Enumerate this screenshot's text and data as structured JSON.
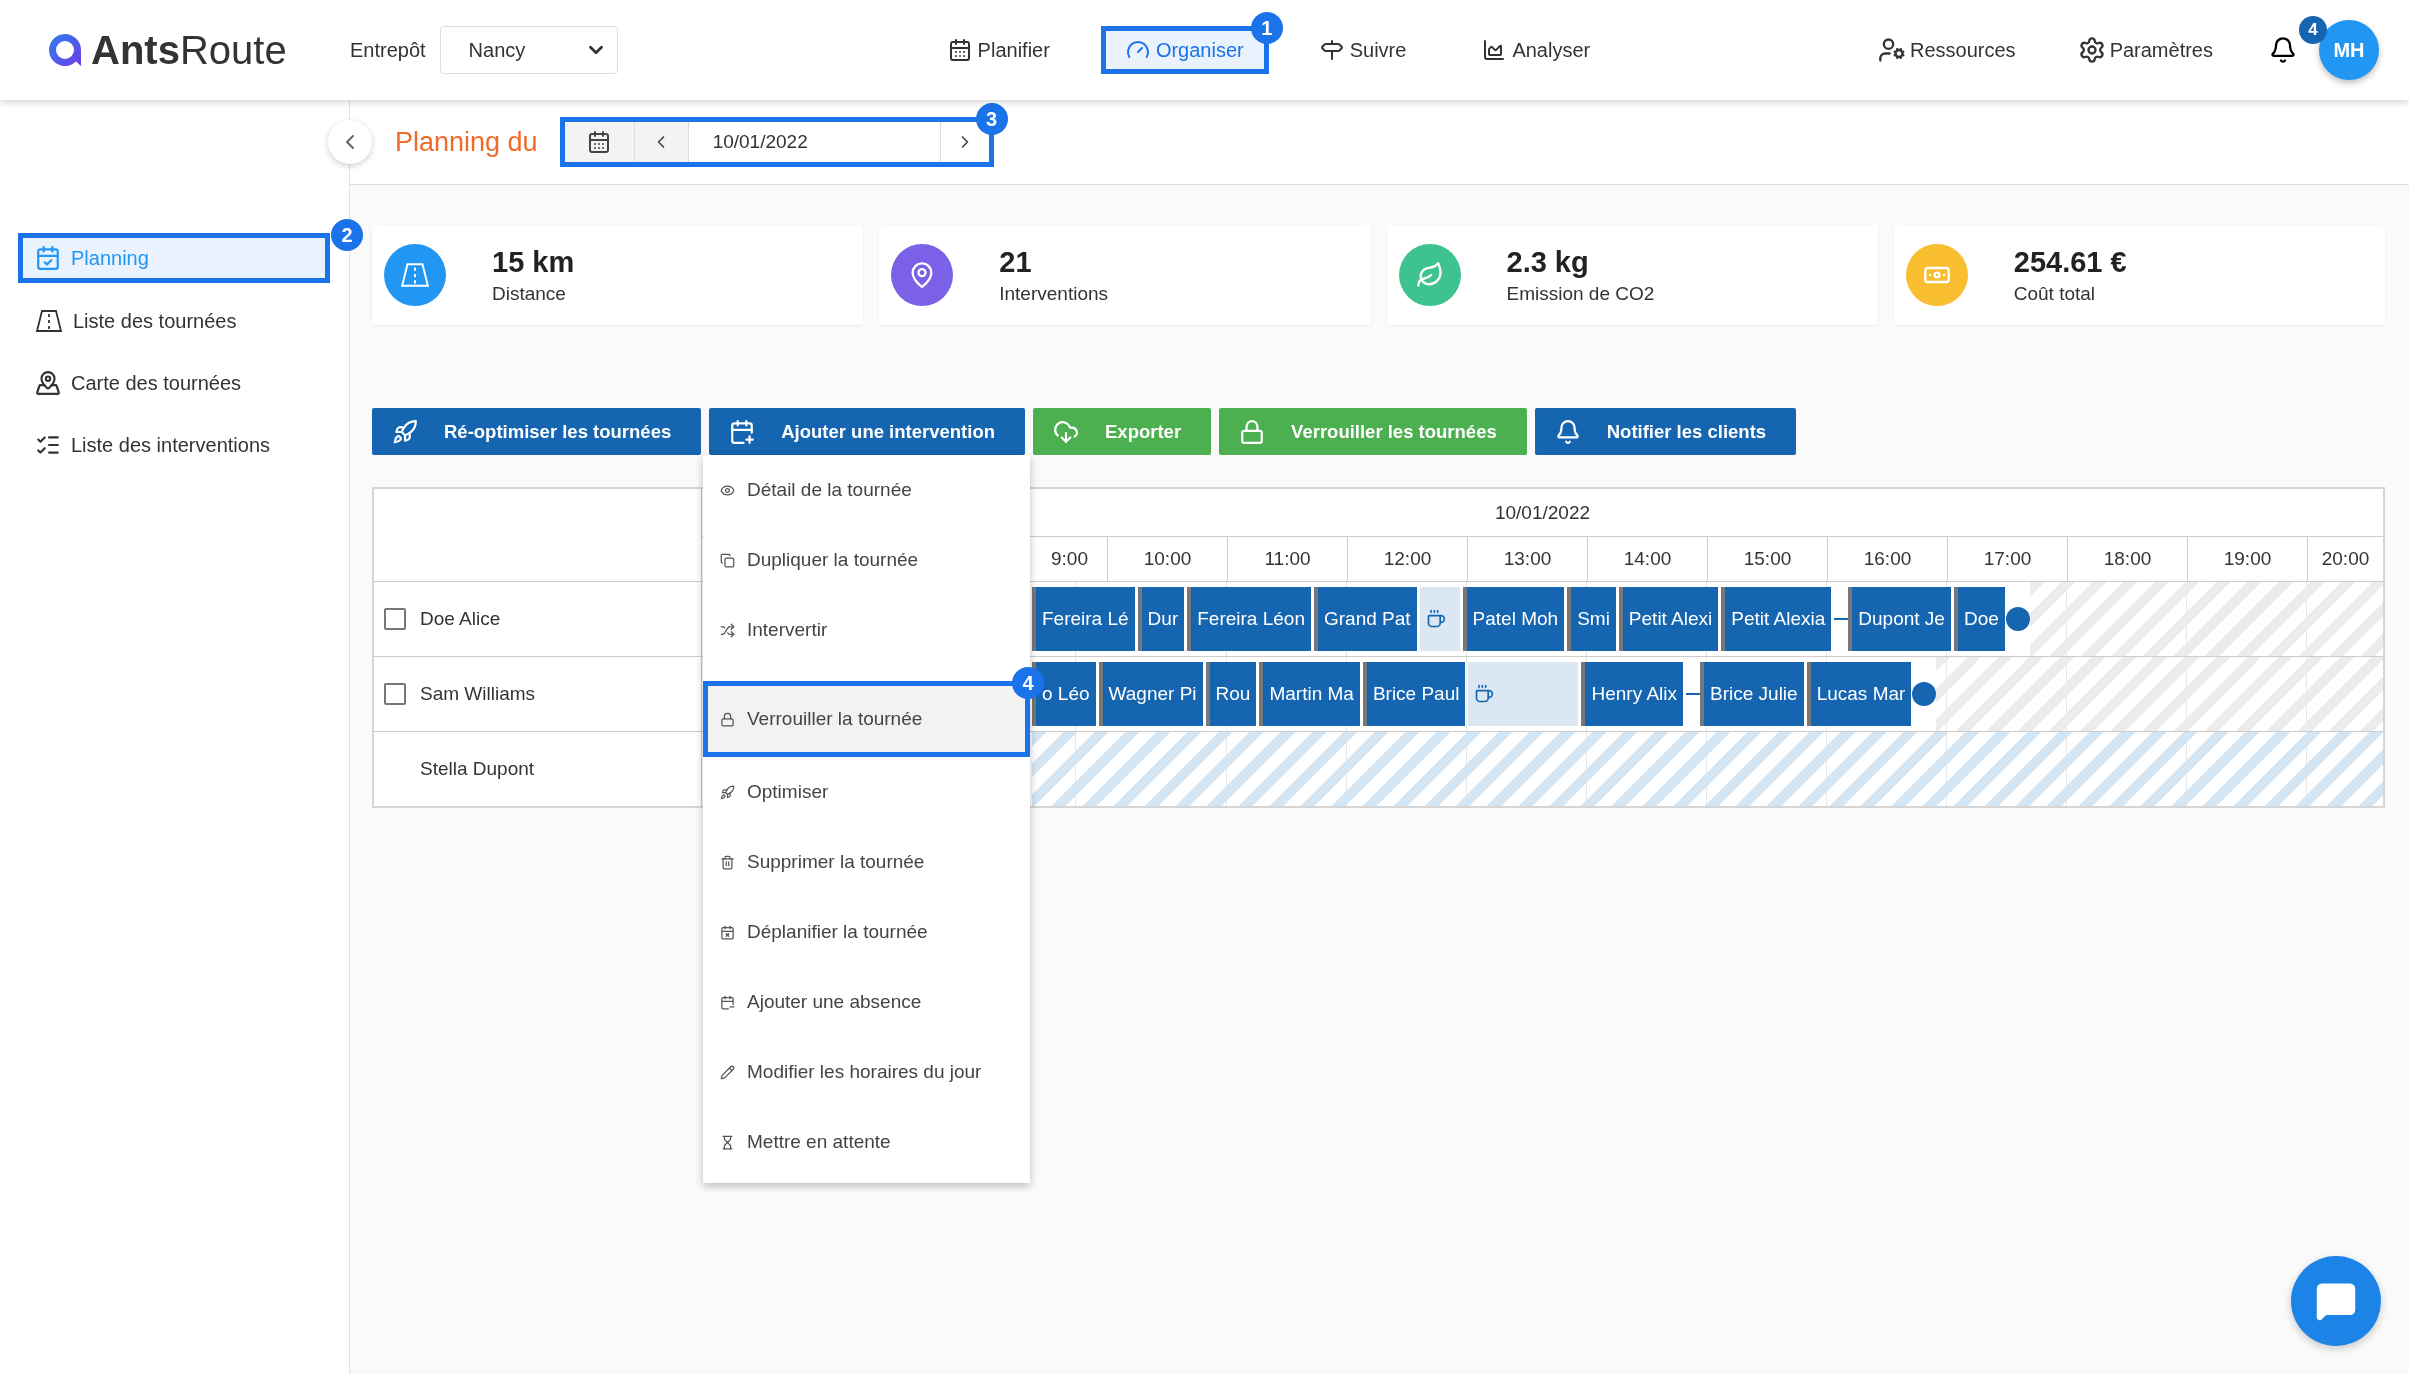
{
  "header": {
    "logo": "**Ants**Route",
    "warehouse_label": "Entrepôt",
    "warehouse": "Nancy",
    "nav": [
      {
        "label": "Planifier",
        "selected": false
      },
      {
        "label": "Organiser",
        "selected": true,
        "step": "1"
      },
      {
        "label": "Suivre",
        "selected": false
      },
      {
        "label": "Analyser",
        "selected": false
      }
    ],
    "tools": [
      "Ressources",
      "Paramètres"
    ],
    "notifications": "4",
    "avatar": "MH"
  },
  "sidebar": {
    "items": [
      {
        "label": "Planning",
        "selected": true,
        "step": "2"
      },
      {
        "label": "Liste des tournées",
        "selected": false
      },
      {
        "label": "Carte des tournées",
        "selected": false
      },
      {
        "label": "Liste des interventions",
        "selected": false
      }
    ]
  },
  "planning": {
    "title": "Planning du",
    "date": "10/01/2022",
    "step": "3"
  },
  "kpis": [
    {
      "value": "15 km",
      "label": "Distance",
      "color": "#2196f3"
    },
    {
      "value": "21",
      "label": "Interventions",
      "color": "#7b61e8"
    },
    {
      "value": "2.3 kg",
      "label": "Emission de CO2",
      "color": "#3ec28f"
    },
    {
      "value": "254.61 €",
      "label": "Coût total",
      "color": "#f9bd30"
    }
  ],
  "actions": [
    {
      "label": "Ré-optimiser les tournées",
      "color": "#1565b0"
    },
    {
      "label": "Ajouter une intervention",
      "color": "#1565b0"
    },
    {
      "label": "Exporter",
      "color": "#4caf50"
    },
    {
      "label": "Verrouiller les tournées",
      "color": "#4caf50"
    },
    {
      "label": "Notifier les clients",
      "color": "#1565b0"
    }
  ],
  "table": {
    "date": "10/01/2022",
    "hours": [
      "9:00",
      "10:00",
      "11:00",
      "12:00",
      "13:00",
      "14:00",
      "15:00",
      "16:00",
      "17:00",
      "18:00",
      "19:00",
      "20:00"
    ],
    "rows": [
      {
        "name": "Doe Alice",
        "kind": "route",
        "checked": false,
        "blocks": [
          {
            "kind": "stop",
            "label": "Fereira Lé"
          },
          {
            "kind": "stop",
            "label": "Dur"
          },
          {
            "kind": "stop",
            "label": "Fereira Léon"
          },
          {
            "kind": "stop",
            "label": "Grand Pat"
          },
          {
            "kind": "break"
          },
          {
            "kind": "stop",
            "label": "Patel Moh"
          },
          {
            "kind": "stop",
            "label": "Smi"
          },
          {
            "kind": "stop",
            "label": "Petit Alexi"
          },
          {
            "kind": "stop",
            "label": "Petit Alexia"
          },
          {
            "kind": "gap"
          },
          {
            "kind": "stop",
            "label": "Dupont Je"
          },
          {
            "kind": "stop",
            "label": "Doe"
          },
          {
            "kind": "end"
          }
        ]
      },
      {
        "name": "Sam Williams",
        "kind": "route",
        "checked": false,
        "blocks": [
          {
            "kind": "stop",
            "label": "o Léo"
          },
          {
            "kind": "stop",
            "label": "Wagner Pi"
          },
          {
            "kind": "stop",
            "label": "Rou"
          },
          {
            "kind": "stop",
            "label": "Martin Ma"
          },
          {
            "kind": "stop",
            "label": "Brice Paul"
          },
          {
            "kind": "break",
            "long": true
          },
          {
            "kind": "stop",
            "label": "Henry Alix"
          },
          {
            "kind": "gap"
          },
          {
            "kind": "stop",
            "label": "Brice Julie"
          },
          {
            "kind": "stop",
            "label": "Lucas Mar"
          },
          {
            "kind": "end"
          }
        ]
      },
      {
        "name": "Stella Dupont",
        "kind": "unavailable"
      }
    ]
  },
  "menu": {
    "items": [
      {
        "label": "Détail de la tournée",
        "selected": false
      },
      {
        "label": "Dupliquer la tournée",
        "selected": false
      },
      {
        "label": "Intervertir",
        "selected": false
      },
      {
        "label": "Verrouiller la tournée",
        "selected": true,
        "step": "4"
      },
      {
        "label": "Optimiser",
        "selected": false
      },
      {
        "label": "Supprimer la tournée",
        "selected": false
      },
      {
        "label": "Déplanifier la tournée",
        "selected": false
      },
      {
        "label": "Ajouter une absence",
        "selected": false
      },
      {
        "label": "Modifier les horaires du jour",
        "selected": false
      },
      {
        "label": "Mettre en attente",
        "selected": false
      }
    ]
  }
}
